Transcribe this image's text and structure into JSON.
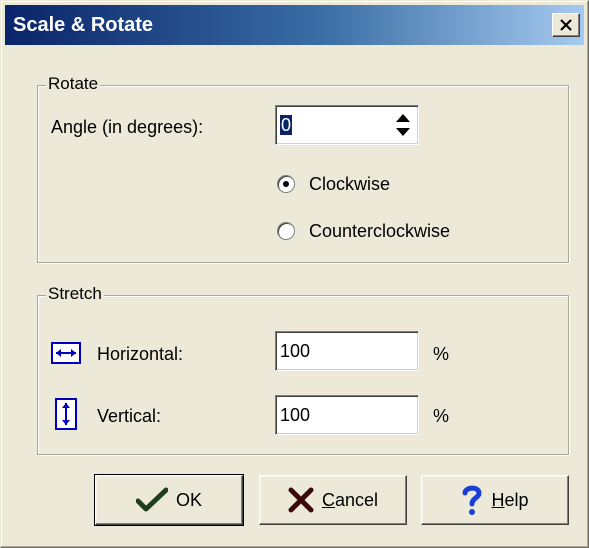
{
  "window": {
    "title": "Scale & Rotate",
    "close_label": "×"
  },
  "rotate": {
    "group_label": "Rotate",
    "angle_label": "Angle (in degrees):",
    "angle_value": "0",
    "clockwise_label": "Clockwise",
    "counterclockwise_label": "Counterclockwise",
    "selected": "clockwise"
  },
  "stretch": {
    "group_label": "Stretch",
    "horizontal_label": "Horizontal:",
    "horizontal_value": "100",
    "vertical_label": "Vertical:",
    "vertical_value": "100",
    "unit": "%"
  },
  "buttons": {
    "ok_label": "OK",
    "cancel_label": "Cancel",
    "help_label": "Help"
  },
  "colors": {
    "title_bar_start": "#0a246a",
    "title_bar_end": "#a6caf0",
    "dialog_bg": "#ece9d8",
    "icon_blue": "#0000c0",
    "ok_check": "#1f3d1f",
    "cancel_x": "#3a0a0a",
    "help_q": "#1a3fd6"
  },
  "icons": {
    "ok": "checkmark-icon",
    "cancel": "x-mark-icon",
    "help": "question-mark-icon",
    "horizontal": "horizontal-stretch-icon",
    "vertical": "vertical-stretch-icon",
    "spin": "spin-arrows-icon"
  }
}
